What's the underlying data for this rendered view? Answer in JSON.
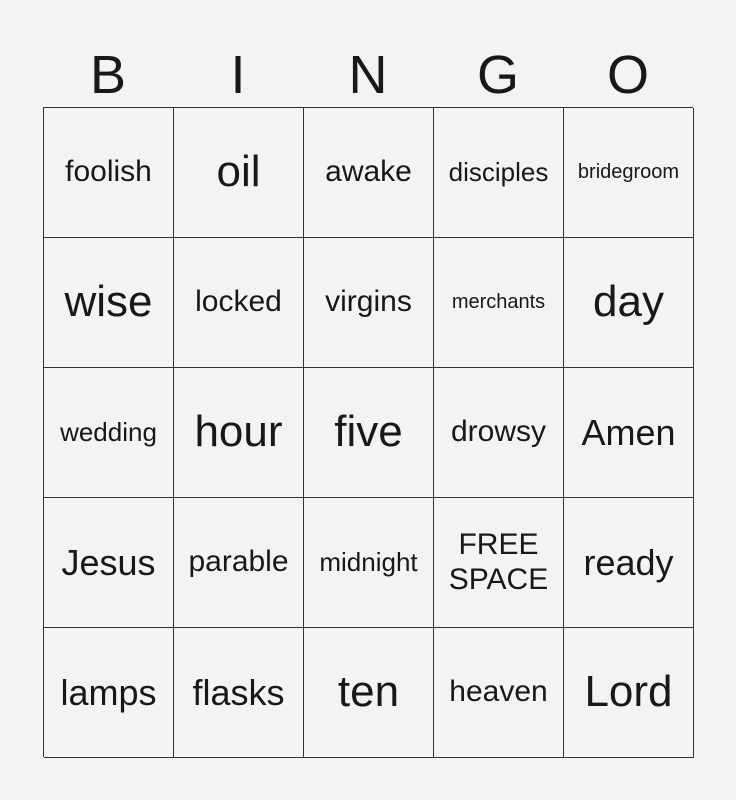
{
  "header": [
    "B",
    "I",
    "N",
    "G",
    "O"
  ],
  "cells": [
    [
      "foolish",
      "oil",
      "awake",
      "disciples",
      "bridegroom"
    ],
    [
      "wise",
      "locked",
      "virgins",
      "merchants",
      "day"
    ],
    [
      "wedding",
      "hour",
      "five",
      "drowsy",
      "Amen"
    ],
    [
      "Jesus",
      "parable",
      "midnight",
      "FREE SPACE",
      "ready"
    ],
    [
      "lamps",
      "flasks",
      "ten",
      "heaven",
      "Lord"
    ]
  ]
}
